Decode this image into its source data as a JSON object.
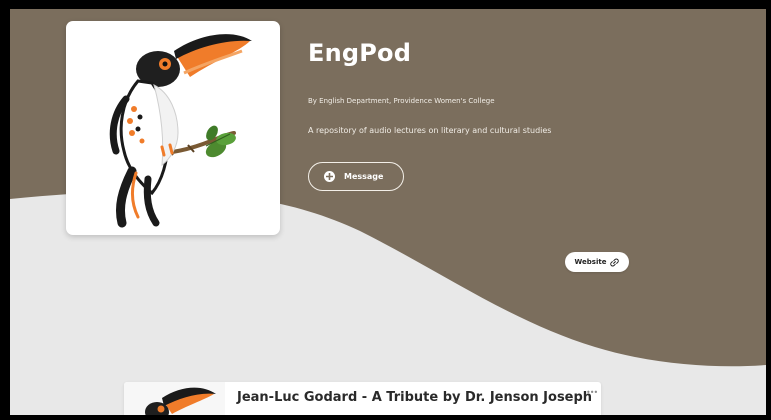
{
  "podcast": {
    "title": "EngPod",
    "byline": "By English Department, Providence Women's College",
    "description": "A repository of audio lectures on literary and cultural studies",
    "cover_icon": "toucan-logo"
  },
  "actions": {
    "message_label": "Message",
    "website_label": "Website"
  },
  "episode": {
    "title": "Jean-Luc Godard - A Tribute by Dr. Jenson Joseph",
    "more_icon": "more-icon"
  },
  "colors": {
    "header_brown": "#7b6e5d",
    "page_background": "#e8e8e8",
    "accent_orange": "#f07c2a"
  }
}
